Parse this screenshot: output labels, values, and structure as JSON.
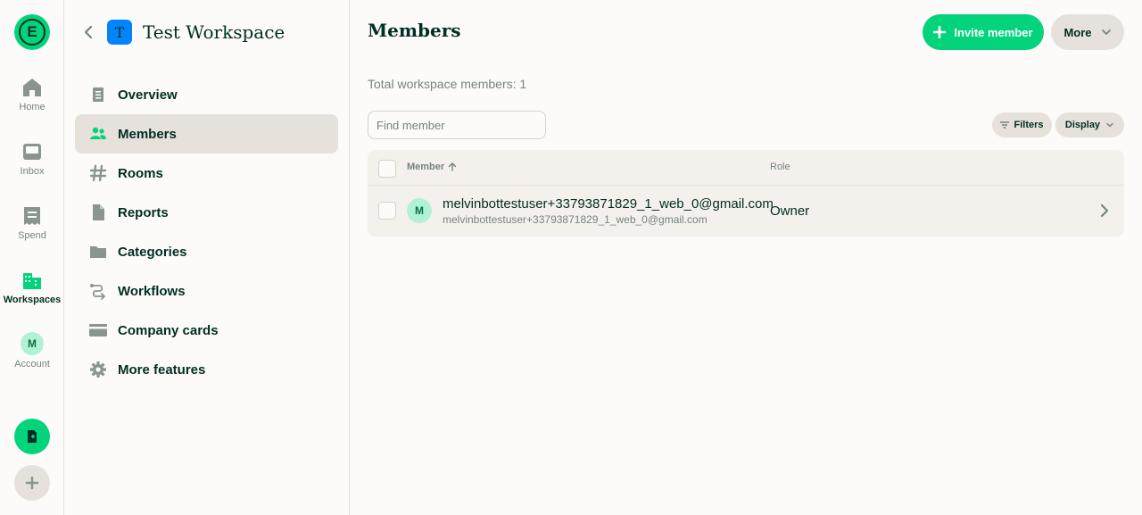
{
  "rail": {
    "logo_letter": "E",
    "items": [
      {
        "label": "Home",
        "icon": "home-icon"
      },
      {
        "label": "Inbox",
        "icon": "inbox-icon"
      },
      {
        "label": "Spend",
        "icon": "receipt-icon"
      },
      {
        "label": "Workspaces",
        "icon": "building-icon",
        "active": true
      },
      {
        "label": "Account",
        "icon": "avatar"
      }
    ],
    "account_initial": "M"
  },
  "workspace": {
    "avatar_letter": "T",
    "title": "Test Workspace"
  },
  "nav": {
    "items": [
      {
        "label": "Overview",
        "icon": "document-icon"
      },
      {
        "label": "Members",
        "icon": "users-icon",
        "active": true
      },
      {
        "label": "Rooms",
        "icon": "hashtag-icon"
      },
      {
        "label": "Reports",
        "icon": "file-icon"
      },
      {
        "label": "Categories",
        "icon": "folder-icon"
      },
      {
        "label": "Workflows",
        "icon": "workflow-icon"
      },
      {
        "label": "Company cards",
        "icon": "credit-card-icon"
      },
      {
        "label": "More features",
        "icon": "gear-icon"
      }
    ]
  },
  "main": {
    "title": "Members",
    "invite_label": "Invite member",
    "more_label": "More",
    "total_text": "Total workspace members: 1",
    "search_placeholder": "Find member",
    "filters_label": "Filters",
    "display_label": "Display",
    "table": {
      "col_member": "Member",
      "col_role": "Role",
      "rows": [
        {
          "initial": "M",
          "name": "melvinbottestuser+33793871829_1_web_0@gmail.com",
          "email": "melvinbottestuser+33793871829_1_web_0@gmail.com",
          "role": "Owner"
        }
      ]
    }
  },
  "colors": {
    "accent": "#03d47c",
    "text": "#002e22",
    "muted": "#76847e",
    "workspace_avatar": "#0185ff"
  }
}
